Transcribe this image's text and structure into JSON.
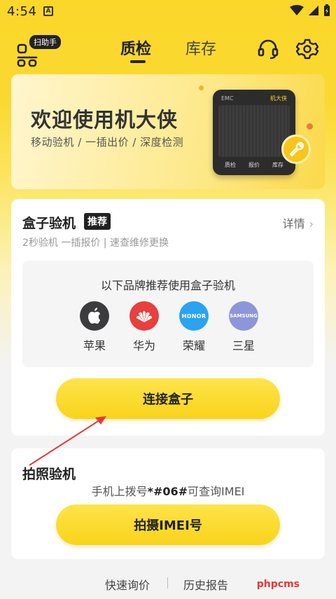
{
  "status_bar": {
    "time": "4:54",
    "notif_letter": "A"
  },
  "header": {
    "scan_badge": "扫助手",
    "tabs": [
      {
        "label": "质检",
        "active": true
      },
      {
        "label": "库存",
        "active": false
      }
    ],
    "icons": [
      "headset-icon",
      "gear-icon"
    ]
  },
  "banner": {
    "title": "欢迎使用机大侠",
    "subtitle": "移动验机 / 一插出价 / 深度检测",
    "device_brand": "机大侠",
    "device_tag": "EMC",
    "device_buttons": [
      "质检",
      "报价",
      "库存"
    ]
  },
  "box_card": {
    "title": "盒子验机",
    "badge": "推荐",
    "detail_link": "详情",
    "subtitle": "2秒验机 一插报价 | 速查维修更换",
    "brand_heading": "以下品牌推荐使用盒子验机",
    "brands": [
      {
        "name": "苹果",
        "color": "#3c3c3e"
      },
      {
        "name": "华为",
        "color": "#e8403c",
        "logo": "HUAWEI"
      },
      {
        "name": "荣耀",
        "color": "#2aa3f0",
        "logo": "HONOR"
      },
      {
        "name": "三星",
        "color": "#8c96d8",
        "logo": "SAMSUNG"
      }
    ],
    "connect_button": "连接盒子"
  },
  "photo_card": {
    "title": "拍照验机",
    "hint_prefix": "手机上拨号",
    "hint_code": "*#06#",
    "hint_suffix": "可查询IMEI",
    "button": "拍摄IMEI号"
  },
  "footer": {
    "links": [
      "快速询价",
      "历史报告"
    ],
    "watermark": "phpcms"
  },
  "colors": {
    "accent_yellow": "#f9d31b",
    "arrow_red": "#e53935"
  }
}
